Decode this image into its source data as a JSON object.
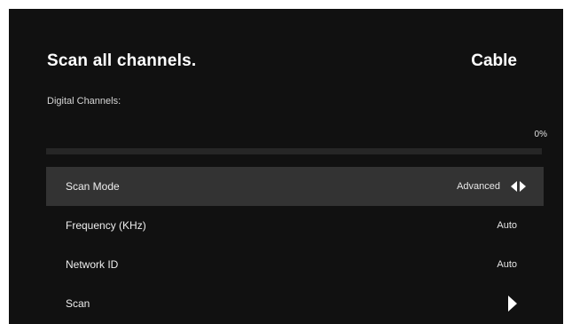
{
  "header": {
    "title": "Scan all channels.",
    "source": "Cable"
  },
  "progress": {
    "label": "Digital Channels:",
    "percent_text": "0%",
    "value": 0
  },
  "menu": {
    "rows": [
      {
        "label": "Scan Mode",
        "value": "Advanced",
        "selected": true
      },
      {
        "label": "Frequency (KHz)",
        "value": "Auto"
      },
      {
        "label": "Network ID",
        "value": "Auto"
      },
      {
        "label": "Scan"
      }
    ]
  },
  "icons": {
    "scan_mode_arrows": "left-right-arrow-icon",
    "scan_go": "play-arrow-icon"
  },
  "colors": {
    "background": "#111111",
    "selected_row": "#333333",
    "text": "#ffffff"
  }
}
